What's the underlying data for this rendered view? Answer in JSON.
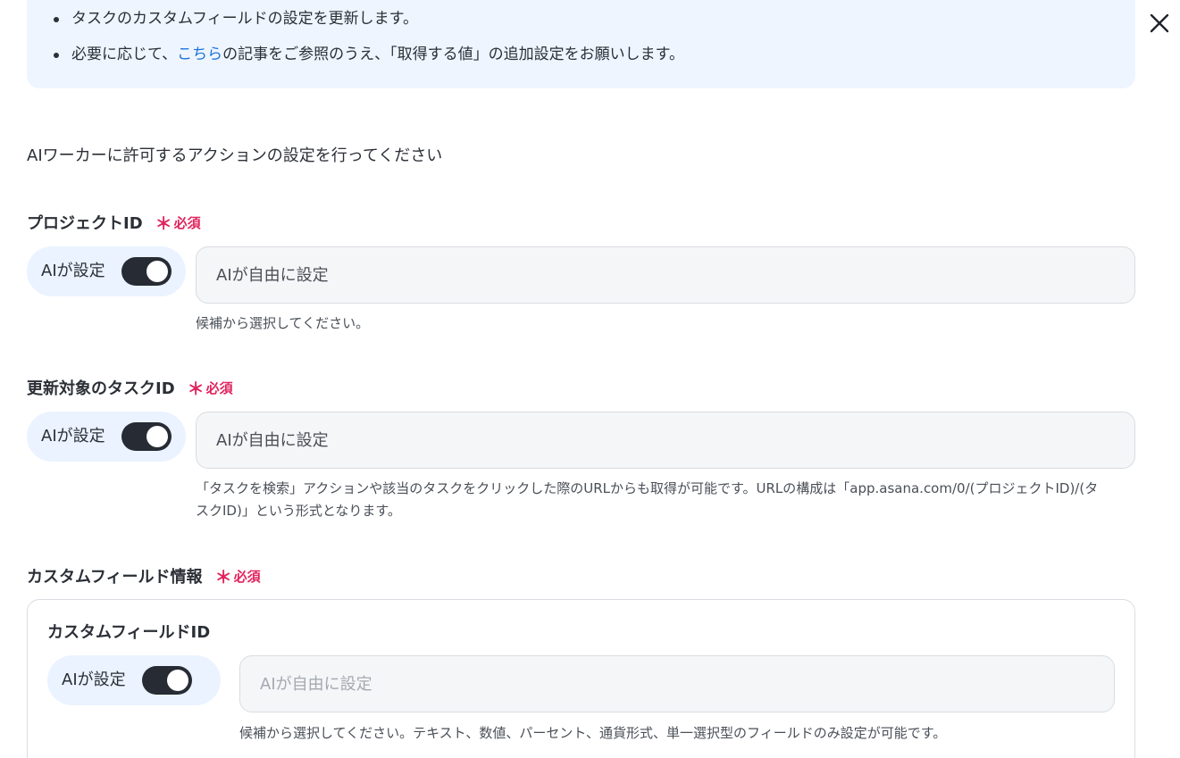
{
  "close_icon": "close-icon",
  "notice": {
    "line1": "タスクのカスタムフィールドの設定を更新します。",
    "line2_before": "必要に応じて、",
    "line2_link": "こちら",
    "line2_after": "の記事をご参照のうえ、「取得する値」の追加設定をお願いします。"
  },
  "intro": "AIワーカーに許可するアクションの設定を行ってください",
  "required_label": "必須",
  "required_mark": "＊",
  "ai_toggle_label": "AIが設定",
  "fields": {
    "project_id": {
      "label": "プロジェクトID",
      "placeholder": "AIが自由に設定",
      "hint": "候補から選択してください。",
      "ai_enabled": true
    },
    "task_id": {
      "label": "更新対象のタスクID",
      "placeholder": "AIが自由に設定",
      "hint": "「タスクを検索」アクションや該当のタスクをクリックした際のURLからも取得が可能です。URLの構成は「app.asana.com/0/(プロジェクトID)/(タスクID)」という形式となります。",
      "ai_enabled": true
    },
    "custom_field_info": {
      "label": "カスタムフィールド情報",
      "sub_label": "カスタムフィールドID",
      "placeholder": "AIが自由に設定",
      "hint": "候補から選択してください。テキスト、数値、パーセント、通貨形式、単一選択型のフィールドのみ設定が可能です。",
      "ai_enabled": true
    }
  },
  "colors": {
    "accent_link": "#1a73d9",
    "required": "#e0245e",
    "toggle_on": "#272b33",
    "notice_bg": "#eef5ff",
    "pill_bg": "#eaf3ff"
  }
}
